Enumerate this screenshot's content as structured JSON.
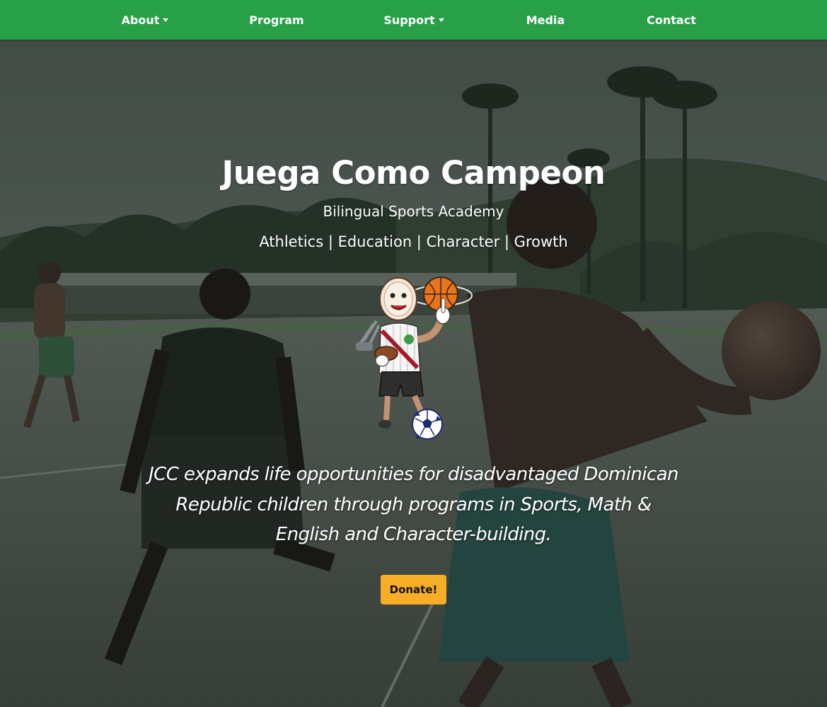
{
  "nav": {
    "items": [
      {
        "label": "About",
        "has_dropdown": true
      },
      {
        "label": "Program",
        "has_dropdown": false
      },
      {
        "label": "Support",
        "has_dropdown": true
      },
      {
        "label": "Media",
        "has_dropdown": false
      },
      {
        "label": "Contact",
        "has_dropdown": false
      }
    ]
  },
  "hero": {
    "title": "Juega Como Campeon",
    "subtitle": "Bilingual Sports Academy",
    "pillars": "Athletics | Education | Character | Growth",
    "mission": "JCC expands life opportunities for disadvantaged Dominican Republic children through programs in Sports, Math & English and Character-building.",
    "donate_label": "Donate!"
  },
  "colors": {
    "nav_bg": "#27a048",
    "donate_bg": "#f7ad25",
    "text": "#ffffff"
  },
  "icons": [
    "chevron-down-icon",
    "mascot-logo",
    "basketball-icon",
    "soccer-ball-icon"
  ]
}
